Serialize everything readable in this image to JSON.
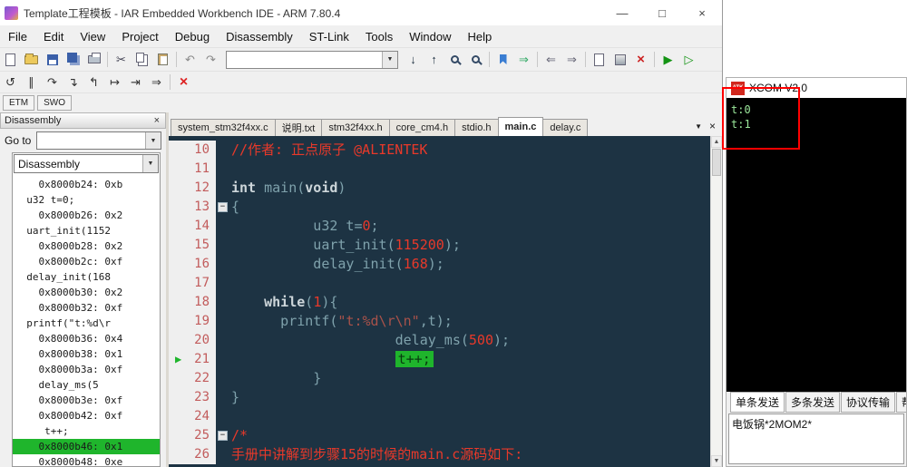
{
  "window": {
    "title": "Template工程模板 - IAR Embedded Workbench IDE - ARM 7.80.4",
    "minimize": "—",
    "maximize": "□",
    "close": "×"
  },
  "menu": [
    "File",
    "Edit",
    "View",
    "Project",
    "Debug",
    "Disassembly",
    "ST-Link",
    "Tools",
    "Window",
    "Help"
  ],
  "toolbar_main_left": [
    {
      "name": "new-file-icon",
      "cls": "g-page"
    },
    {
      "name": "open-file-icon",
      "cls": "g-folder"
    },
    {
      "name": "save-icon",
      "cls": "g-floppy"
    },
    {
      "name": "save-all-icon",
      "cls": "g-floppy2"
    },
    {
      "name": "print-icon",
      "cls": "g-print"
    },
    {
      "sep": true
    },
    {
      "name": "cut-icon",
      "glyph": "✂",
      "color": "#445"
    },
    {
      "name": "copy-icon",
      "cls": "g-copy"
    },
    {
      "name": "paste-icon",
      "cls": "g-paste"
    },
    {
      "sep": true
    },
    {
      "name": "undo-icon",
      "glyph": "↶",
      "color": "#8a8a8a"
    },
    {
      "name": "redo-icon",
      "glyph": "↷",
      "color": "#8a8a8a"
    }
  ],
  "toolbar_main_right": [
    {
      "name": "find-next-icon",
      "glyph": "↓",
      "color": "#234"
    },
    {
      "name": "find-previous-icon",
      "glyph": "↑",
      "color": "#234"
    },
    {
      "name": "find-icon",
      "cls": "g-mag"
    },
    {
      "name": "replace-icon",
      "cls": "g-mag"
    },
    {
      "sep": true
    },
    {
      "name": "toggle-bookmark-icon",
      "cls": "g-bm"
    },
    {
      "name": "next-bookmark-icon",
      "glyph": "⇒",
      "color": "#3a6"
    },
    {
      "sep": true
    },
    {
      "name": "navigate-backward-icon",
      "glyph": "⇐",
      "color": "#667"
    },
    {
      "name": "navigate-forward-icon",
      "glyph": "⇒",
      "color": "#667"
    },
    {
      "sep": true
    },
    {
      "name": "compile-icon",
      "cls": "g-page"
    },
    {
      "name": "make-icon",
      "cls": "g-make"
    },
    {
      "name": "stop-build-icon",
      "glyph": "×",
      "color": "#c22",
      "size": 15
    },
    {
      "sep": true
    },
    {
      "name": "download-and-debug-icon",
      "glyph": "▶",
      "color": "#149414"
    },
    {
      "name": "debug-without-download-icon",
      "glyph": "▷",
      "color": "#149414"
    }
  ],
  "toolbar_debug": [
    {
      "name": "reset-icon",
      "glyph": "↺",
      "color": "#333"
    },
    {
      "name": "break-icon",
      "glyph": "∥",
      "color": "#333"
    },
    {
      "name": "step-over-icon",
      "glyph": "↷",
      "color": "#333"
    },
    {
      "name": "step-into-icon",
      "glyph": "↴",
      "color": "#333"
    },
    {
      "name": "step-out-icon",
      "glyph": "↰",
      "color": "#333"
    },
    {
      "name": "next-statement-icon",
      "glyph": "↦",
      "color": "#333"
    },
    {
      "name": "run-to-cursor-icon",
      "glyph": "⇥",
      "color": "#333"
    },
    {
      "name": "go-icon",
      "glyph": "⇒",
      "color": "#333"
    },
    {
      "sep": true
    },
    {
      "name": "stop-debugger-icon",
      "glyph": "×",
      "color": "#d22",
      "size": 16
    }
  ],
  "trace_buttons": [
    "ETM",
    "SWO"
  ],
  "disassembly": {
    "title": "Disassembly",
    "close": "×",
    "goto_label": "Go to",
    "zone": "Disassembly",
    "rows": [
      {
        "t": "    0x8000b24: 0xb"
      },
      {
        "t": "  u32 t=0;"
      },
      {
        "t": "    0x8000b26: 0x2"
      },
      {
        "t": "  uart_init(1152"
      },
      {
        "t": "    0x8000b28: 0x2"
      },
      {
        "t": "    0x8000b2c: 0xf"
      },
      {
        "t": "  delay_init(168"
      },
      {
        "t": "    0x8000b30: 0x2"
      },
      {
        "t": "    0x8000b32: 0xf"
      },
      {
        "t": "  printf(\"t:%d\\r"
      },
      {
        "t": "    0x8000b36: 0x4"
      },
      {
        "t": "    0x8000b38: 0x1"
      },
      {
        "t": "    0x8000b3a: 0xf"
      },
      {
        "t": "    delay_ms(5"
      },
      {
        "t": "    0x8000b3e: 0xf"
      },
      {
        "t": "    0x8000b42: 0xf"
      },
      {
        "t": "     t++;"
      },
      {
        "t": "    0x8000b46: 0x1",
        "hl": true
      },
      {
        "t": "    0x8000b48: 0xe"
      }
    ]
  },
  "editor": {
    "tabs": [
      {
        "label": "system_stm32f4xx.c"
      },
      {
        "label": "说明.txt"
      },
      {
        "label": "stm32f4xx.h"
      },
      {
        "label": "core_cm4.h"
      },
      {
        "label": "stdio.h"
      },
      {
        "label": "main.c",
        "active": true
      },
      {
        "label": "delay.c"
      }
    ],
    "tab_menu_icon": "▼",
    "tab_close_icon": "×",
    "lines": [
      {
        "num": 10,
        "segs": [
          [
            "c",
            "//作者: 正点原子 @ALIENTEK"
          ]
        ]
      },
      {
        "num": 11,
        "segs": []
      },
      {
        "num": 12,
        "segs": [
          [
            "k",
            "int"
          ],
          [
            "d",
            " main("
          ],
          [
            "k",
            "void"
          ],
          [
            "d",
            ")"
          ]
        ]
      },
      {
        "num": 13,
        "fold": true,
        "segs": [
          [
            "d",
            "{"
          ]
        ]
      },
      {
        "num": 14,
        "segs": [
          [
            "d",
            "          u32 t="
          ],
          [
            "n",
            "0"
          ],
          [
            "d",
            ";"
          ]
        ]
      },
      {
        "num": 15,
        "segs": [
          [
            "d",
            "          uart_init("
          ],
          [
            "n",
            "115200"
          ],
          [
            "d",
            ");"
          ]
        ]
      },
      {
        "num": 16,
        "segs": [
          [
            "d",
            "          delay_init("
          ],
          [
            "n",
            "168"
          ],
          [
            "d",
            ");"
          ]
        ]
      },
      {
        "num": 17,
        "segs": []
      },
      {
        "num": 18,
        "segs": [
          [
            "d",
            "    "
          ],
          [
            "k",
            "while"
          ],
          [
            "d",
            "("
          ],
          [
            "n",
            "1"
          ],
          [
            "d",
            "){"
          ]
        ]
      },
      {
        "num": 19,
        "segs": [
          [
            "d",
            "      printf("
          ],
          [
            "s",
            "\"t:%d\\r\\n\""
          ],
          [
            "d",
            ",t);"
          ]
        ]
      },
      {
        "num": 20,
        "segs": [
          [
            "d",
            "                    delay_ms("
          ],
          [
            "n",
            "500"
          ],
          [
            "d",
            ");"
          ]
        ]
      },
      {
        "num": 21,
        "arrow": true,
        "segs": [
          [
            "d",
            "                    "
          ],
          [
            "x",
            "t++;"
          ]
        ]
      },
      {
        "num": 22,
        "segs": [
          [
            "d",
            "          }"
          ]
        ]
      },
      {
        "num": 23,
        "segs": [
          [
            "d",
            "}"
          ]
        ]
      },
      {
        "num": 24,
        "segs": []
      },
      {
        "num": 25,
        "fold": true,
        "segs": [
          [
            "c",
            "/*"
          ]
        ]
      },
      {
        "num": 26,
        "segs": [
          [
            "c",
            "手册中讲解到步骤15的时候的main.c源码如下:"
          ]
        ]
      }
    ]
  },
  "xcom": {
    "logo": "ATK",
    "title": "XCOM V2.0",
    "terminal": [
      "t:0",
      "t:1"
    ],
    "tabs": [
      {
        "label": "单条发送",
        "active": true
      },
      {
        "label": "多条发送"
      },
      {
        "label": "协议传输"
      },
      {
        "label": "帮助"
      }
    ],
    "input": "电饭锅*2MOM2*"
  },
  "colors": {
    "exec_green": "#1fb52c",
    "annotation_red": "#ff0000",
    "editor_bg": "#1d3343",
    "comment_red": "#e8392a",
    "string_red": "#a8524a",
    "terminal_green": "#9ce89c"
  }
}
